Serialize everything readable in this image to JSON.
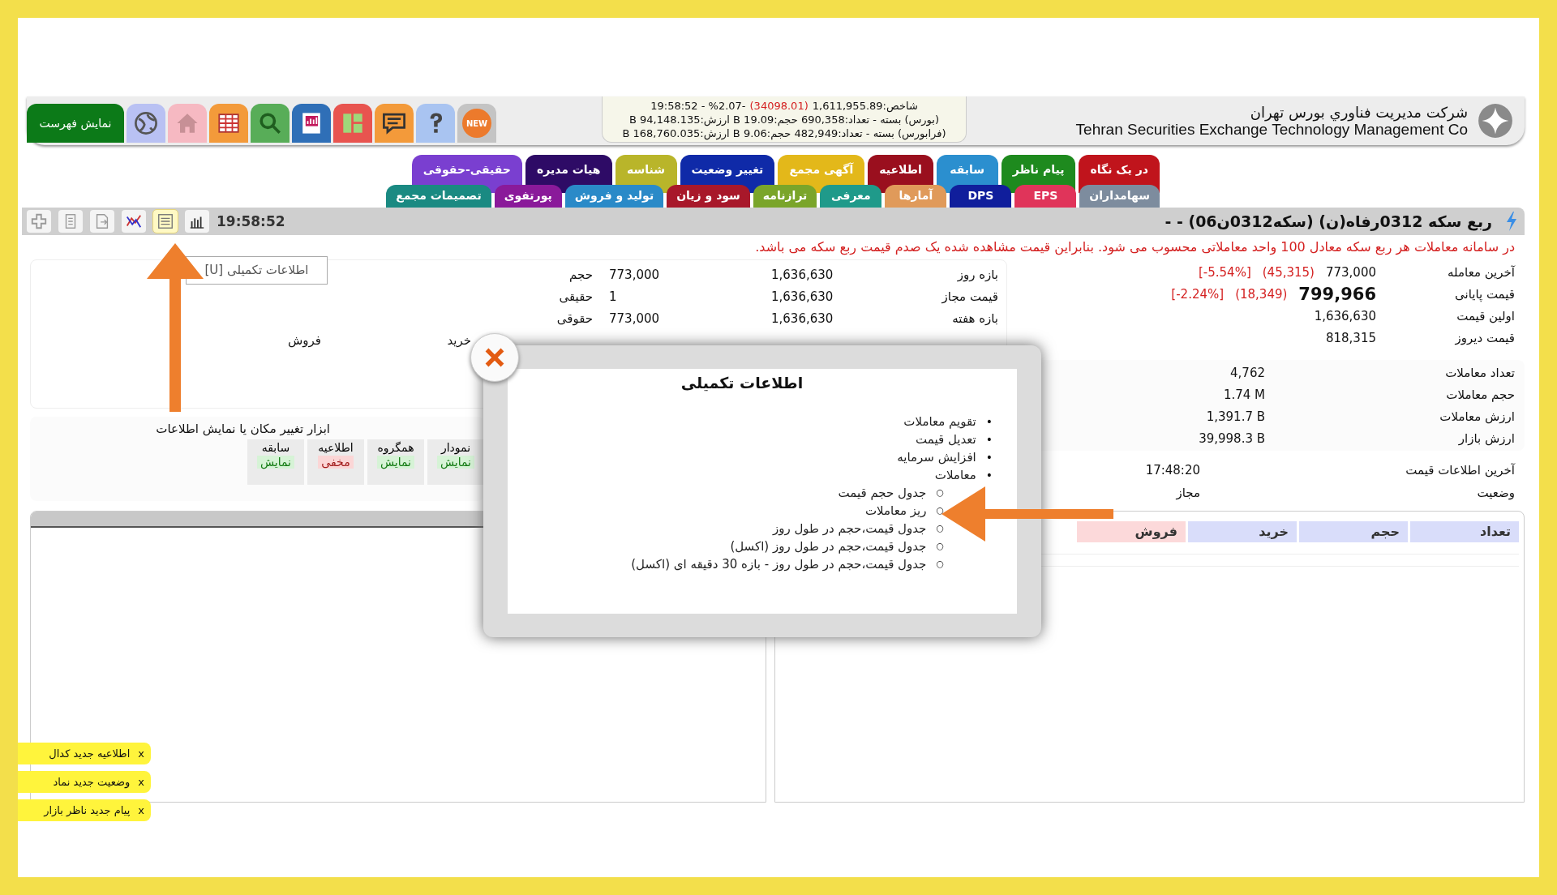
{
  "header": {
    "menu_button": "نمایش فهرست",
    "new_badge": "NEW",
    "index_box": {
      "line_1": {
        "label": "شاخص:1,611,955.89",
        "change": "(34098.01)",
        "rest": "19:58:52 - %2.07-"
      },
      "line_2": "(بورس) بسته - تعداد:690,358 حجم:19.09 B ارزش:94,148.135 B",
      "line_3": "(فرابورس) بسته - تعداد:482,949 حجم:9.06 B ارزش:168,760.035 B"
    },
    "company": {
      "name_fa": "شرکت مدیریت فناوري بورس تهران",
      "name_en": "Tehran Securities Exchange Technology Management Co"
    }
  },
  "tabs_row_1": [
    {
      "label": "در یک نگاه",
      "color": "#c0141c"
    },
    {
      "label": "پیام ناظر",
      "color": "#1e8a1e"
    },
    {
      "label": "سابقه",
      "color": "#2b8fcf"
    },
    {
      "label": "اطلاعیه",
      "color": "#9a0f1e"
    },
    {
      "label": "آگهی مجمع",
      "color": "#e3b81a"
    },
    {
      "label": "تغییر وضعیت",
      "color": "#0f2aa8"
    },
    {
      "label": "شناسه",
      "color": "#b9b52a"
    },
    {
      "label": "هیات مدیره",
      "color": "#2e0b66"
    },
    {
      "label": "حقیقی-حقوقی",
      "color": "#7a3fd0"
    }
  ],
  "tabs_row_2": [
    {
      "label": "سهامداران",
      "color": "#7d8c9e"
    },
    {
      "label": "EPS",
      "color": "#e0345a"
    },
    {
      "label": "DPS",
      "color": "#101e9c"
    },
    {
      "label": "آمارها",
      "color": "#e09a5a"
    },
    {
      "label": "معرفی",
      "color": "#1f9a8a"
    },
    {
      "label": "ترازنامه",
      "color": "#7aa52a"
    },
    {
      "label": "سود و زیان",
      "color": "#a8182a"
    },
    {
      "label": "تولید و فروش",
      "color": "#2a8ac8"
    },
    {
      "label": "پورتفوی",
      "color": "#8a1a9a"
    },
    {
      "label": "تصمیمات مجمع",
      "color": "#1a8a82"
    }
  ],
  "toolbar": {
    "time": "19:58:52",
    "tooltip": "اطلاعات تکمیلی [U]",
    "symbol_title": "ربع سکه 0312رفاه(ن) (سکه0312ن06) - -",
    "tools": [
      {
        "kind": "plus",
        "selected": false
      },
      {
        "kind": "document",
        "selected": false
      },
      {
        "kind": "export",
        "selected": false
      },
      {
        "kind": "chart",
        "selected": false
      },
      {
        "kind": "list",
        "selected": true
      },
      {
        "kind": "bars",
        "selected": false
      }
    ]
  },
  "notice": "در سامانه معاملات هر ربع سکه معادل 100 واحد معاملاتی محسوب می شود. بنابراین قیمت مشاهده شده یک صدم قیمت ربع سکه می باشد.",
  "price_rows": [
    {
      "label": "آخرین معامله",
      "value": "773,000",
      "change": "(45,315)",
      "percent": "[-5.54%]",
      "emphasis": false
    },
    {
      "label": "قیمت پایانی",
      "value": "799,966",
      "change": "(18,349)",
      "percent": "[-2.24%]",
      "emphasis": true
    },
    {
      "label": "اولین قیمت",
      "value": "1,636,630",
      "emphasis": false
    },
    {
      "label": "قیمت دیروز",
      "value": "818,315",
      "emphasis": false
    }
  ],
  "range_rows": [
    {
      "label": "بازه روز",
      "value": "1,636,630",
      "volume_value": "773,000",
      "volume_label": "حجم"
    },
    {
      "label": "قیمت مجاز",
      "value": "1,636,630",
      "volume_value": "1",
      "volume_label": "حقیقی"
    },
    {
      "label": "بازه هفته",
      "value": "1,636,630",
      "volume_value": "773,000",
      "volume_label": "حقوقی"
    }
  ],
  "buy_sell": [
    "خرید",
    "فروش"
  ],
  "stats": [
    {
      "label": "تعداد معاملات",
      "value": "4,762"
    },
    {
      "label": "حجم معاملات",
      "value": "1.74 M"
    },
    {
      "label": "ارزش معاملات",
      "value": "1,391.7 B"
    },
    {
      "label": "ارزش بازار",
      "value": "39,998.3 B"
    }
  ],
  "status_rows": [
    {
      "label": "آخرین اطلاعات قیمت",
      "value": "17:48:20"
    },
    {
      "label": "وضعیت",
      "value": "مجاز"
    }
  ],
  "display_tools": {
    "caption": "ابزار تغییر مکان یا نمایش اطلاعات",
    "items": [
      {
        "name": "نمودار",
        "state": "نمایش",
        "visible": true
      },
      {
        "name": "همگروه",
        "state": "نمایش",
        "visible": true
      },
      {
        "name": "اطلاعیه",
        "state": "مخفی",
        "visible": false
      },
      {
        "name": "سابقه",
        "state": "نمایش",
        "visible": true
      }
    ]
  },
  "trades_table": {
    "columns": [
      {
        "label": "تعداد",
        "color": "#d9ddfa"
      },
      {
        "label": "حجم",
        "color": "#d9ddfa"
      },
      {
        "label": "خرید",
        "color": "#d9ddfa"
      },
      {
        "label": "فروش",
        "color": "#fcd9da"
      }
    ]
  },
  "modal": {
    "title": "اطلاعات تکمیلی",
    "items": [
      {
        "marker": "•",
        "text": "تقویم معاملات"
      },
      {
        "marker": "•",
        "text": "تعدیل قیمت"
      },
      {
        "marker": "•",
        "text": "افزایش سرمایه"
      },
      {
        "marker": "•",
        "text": "معاملات",
        "children": [
          {
            "marker": "○",
            "text": "جدول حجم قیمت"
          },
          {
            "marker": "○",
            "text": "ریز معاملات"
          },
          {
            "marker": "○",
            "text": "جدول قیمت،حجم در طول روز"
          },
          {
            "marker": "○",
            "text": "جدول قیمت،حجم در طول روز (اکسل)"
          },
          {
            "marker": "○",
            "text": "جدول قیمت،حجم در طول روز - بازه 30 دقیقه ای (اکسل)"
          }
        ]
      }
    ]
  },
  "notifications": [
    {
      "close": "x",
      "text": "اطلاعیه جدید کدال"
    },
    {
      "close": "x",
      "text": "وضعیت جدید نماد"
    },
    {
      "close": "x",
      "text": "پیام جدید ناظر بازار"
    }
  ]
}
